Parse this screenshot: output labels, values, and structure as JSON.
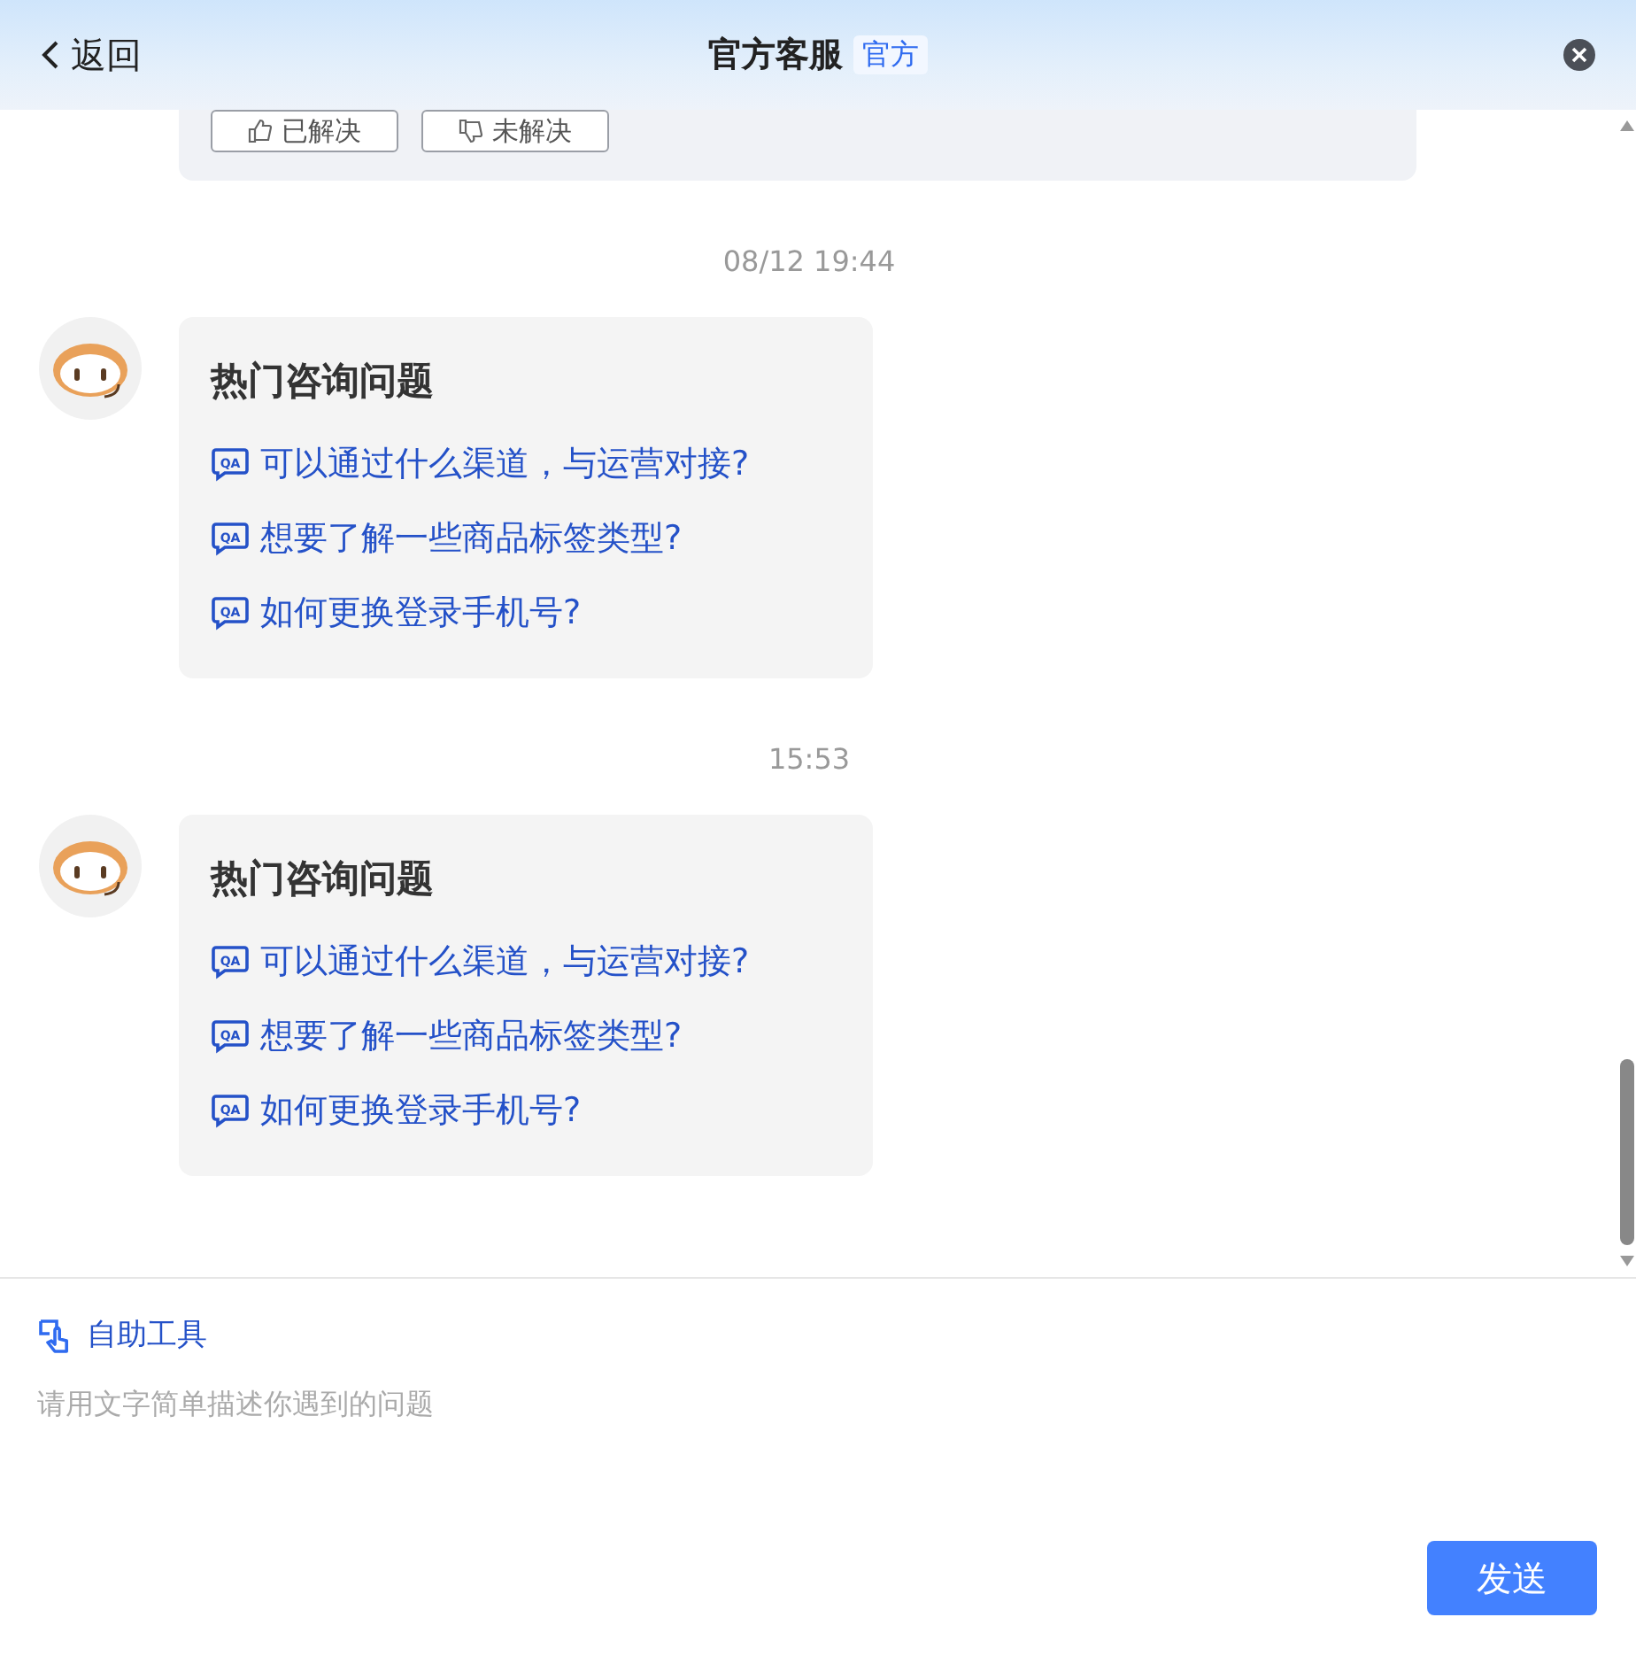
{
  "header": {
    "back_label": "返回",
    "title": "官方客服",
    "badge": "官方"
  },
  "feedback": {
    "buttons": [
      "已解决",
      "未解决"
    ]
  },
  "messages": [
    {
      "kind": "time",
      "text": "08/12 19:44"
    },
    {
      "kind": "faq",
      "title": "热门咨询问题",
      "questions": [
        {
          "icon_label": "QA",
          "text": "可以通过什么渠道，与运营对接?"
        },
        {
          "icon_label": "QA",
          "text": "想要了解一些商品标签类型?"
        },
        {
          "icon_label": "QA",
          "text": "如何更换登录手机号?"
        }
      ]
    },
    {
      "kind": "time",
      "text": "15:53"
    },
    {
      "kind": "faq",
      "title": "热门咨询问题",
      "questions": [
        {
          "icon_label": "QA",
          "text": "可以通过什么渠道，与运营对接?"
        },
        {
          "icon_label": "QA",
          "text": "想要了解一些商品标签类型?"
        },
        {
          "icon_label": "QA",
          "text": "如何更换登录手机号?"
        }
      ]
    }
  ],
  "composer": {
    "tool_label": "自助工具",
    "placeholder": "请用文字简单描述你遇到的问题",
    "send_label": "发送"
  }
}
